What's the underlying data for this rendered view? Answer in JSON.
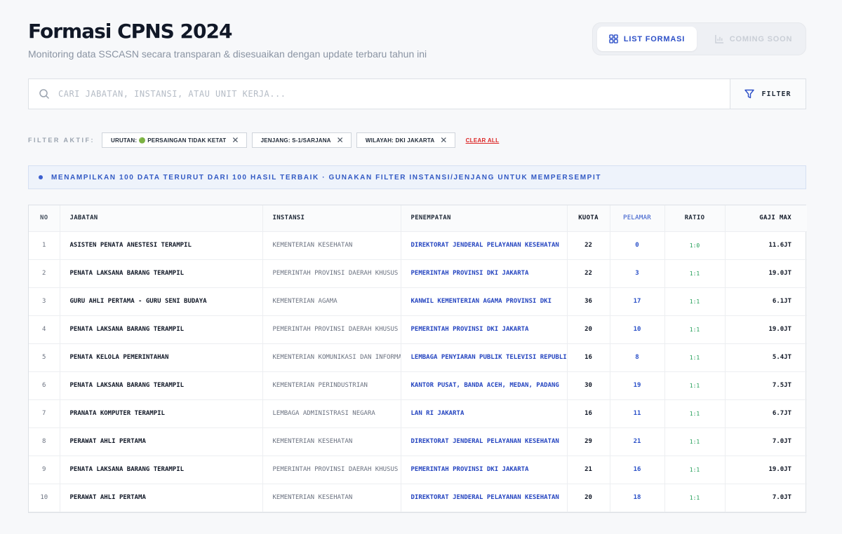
{
  "header": {
    "title": "Formasi CPNS 2024",
    "subtitle": "Monitoring data SSCASN secara transparan & disesuaikan dengan update terbaru tahun ini"
  },
  "view_toggle": {
    "list_label": "LIST FORMASI",
    "coming_label": "COMING SOON"
  },
  "search": {
    "placeholder": "CARI JABATAN, INSTANSI, ATAU UNIT KERJA...",
    "filter_label": "FILTER"
  },
  "active_filters": {
    "label": "FILTER AKTIF:",
    "chips": [
      "URUTAN: 🟢 PERSAINGAN TIDAK KETAT",
      "JENJANG: S-1/SARJANA",
      "WILAYAH: DKI JAKARTA"
    ],
    "clear_label": "CLEAR ALL"
  },
  "banner": {
    "text": "MENAMPILKAN 100 DATA TERURUT DARI 100 HASIL TERBAIK · GUNAKAN FILTER INSTANSI/JENJANG UNTUK MEMPERSEMPIT"
  },
  "table": {
    "columns": [
      "NO",
      "JABATAN",
      "INSTANSI",
      "PENEMPATAN",
      "KUOTA",
      "PELAMAR",
      "RATIO",
      "GAJI MAX"
    ],
    "rows": [
      {
        "no": "1",
        "jabatan": "ASISTEN PENATA ANESTESI TERAMPIL",
        "instansi": "KEMENTERIAN KESEHATAN",
        "penempatan": "DIREKTORAT JENDERAL PELAYANAN KESEHATAN",
        "kuota": "22",
        "pelamar": "0",
        "ratio": "1:0",
        "gaji": "11.6JT"
      },
      {
        "no": "2",
        "jabatan": "PENATA LAKSANA BARANG TERAMPIL",
        "instansi": "PEMERINTAH PROVINSI DAERAH KHUSUS",
        "penempatan": "PEMERINTAH PROVINSI DKI JAKARTA",
        "kuota": "22",
        "pelamar": "3",
        "ratio": "1:1",
        "gaji": "19.0JT"
      },
      {
        "no": "3",
        "jabatan": "GURU AHLI PERTAMA - GURU SENI BUDAYA",
        "instansi": "KEMENTERIAN AGAMA",
        "penempatan": "KANWIL KEMENTERIAN AGAMA PROVINSI DKI",
        "kuota": "36",
        "pelamar": "17",
        "ratio": "1:1",
        "gaji": "6.1JT"
      },
      {
        "no": "4",
        "jabatan": "PENATA LAKSANA BARANG TERAMPIL",
        "instansi": "PEMERINTAH PROVINSI DAERAH KHUSUS",
        "penempatan": "PEMERINTAH PROVINSI DKI JAKARTA",
        "kuota": "20",
        "pelamar": "10",
        "ratio": "1:1",
        "gaji": "19.0JT"
      },
      {
        "no": "5",
        "jabatan": "PENATA KELOLA PEMERINTAHAN",
        "instansi": "KEMENTERIAN KOMUNIKASI DAN INFORMATIKA",
        "penempatan": "LEMBAGA PENYIARAN PUBLIK TELEVISI REPUBLIK",
        "kuota": "16",
        "pelamar": "8",
        "ratio": "1:1",
        "gaji": "5.4JT"
      },
      {
        "no": "6",
        "jabatan": "PENATA LAKSANA BARANG TERAMPIL",
        "instansi": "KEMENTERIAN PERINDUSTRIAN",
        "penempatan": "KANTOR PUSAT, BANDA ACEH, MEDAN, PADANG",
        "kuota": "30",
        "pelamar": "19",
        "ratio": "1:1",
        "gaji": "7.5JT"
      },
      {
        "no": "7",
        "jabatan": "PRANATA KOMPUTER TERAMPIL",
        "instansi": "LEMBAGA ADMINISTRASI NEGARA",
        "penempatan": "LAN RI JAKARTA",
        "kuota": "16",
        "pelamar": "11",
        "ratio": "1:1",
        "gaji": "6.7JT"
      },
      {
        "no": "8",
        "jabatan": "PERAWAT AHLI PERTAMA",
        "instansi": "KEMENTERIAN KESEHATAN",
        "penempatan": "DIREKTORAT JENDERAL PELAYANAN KESEHATAN",
        "kuota": "29",
        "pelamar": "21",
        "ratio": "1:1",
        "gaji": "7.0JT"
      },
      {
        "no": "9",
        "jabatan": "PENATA LAKSANA BARANG TERAMPIL",
        "instansi": "PEMERINTAH PROVINSI DAERAH KHUSUS",
        "penempatan": "PEMERINTAH PROVINSI DKI JAKARTA",
        "kuota": "21",
        "pelamar": "16",
        "ratio": "1:1",
        "gaji": "19.0JT"
      },
      {
        "no": "10",
        "jabatan": "PERAWAT AHLI PERTAMA",
        "instansi": "KEMENTERIAN KESEHATAN",
        "penempatan": "DIREKTORAT JENDERAL PELAYANAN KESEHATAN",
        "kuota": "20",
        "pelamar": "18",
        "ratio": "1:1",
        "gaji": "7.0JT"
      }
    ]
  },
  "colors": {
    "accent": "#2c4fc7",
    "danger": "#dc2626",
    "ratio": "#1f9d55"
  }
}
